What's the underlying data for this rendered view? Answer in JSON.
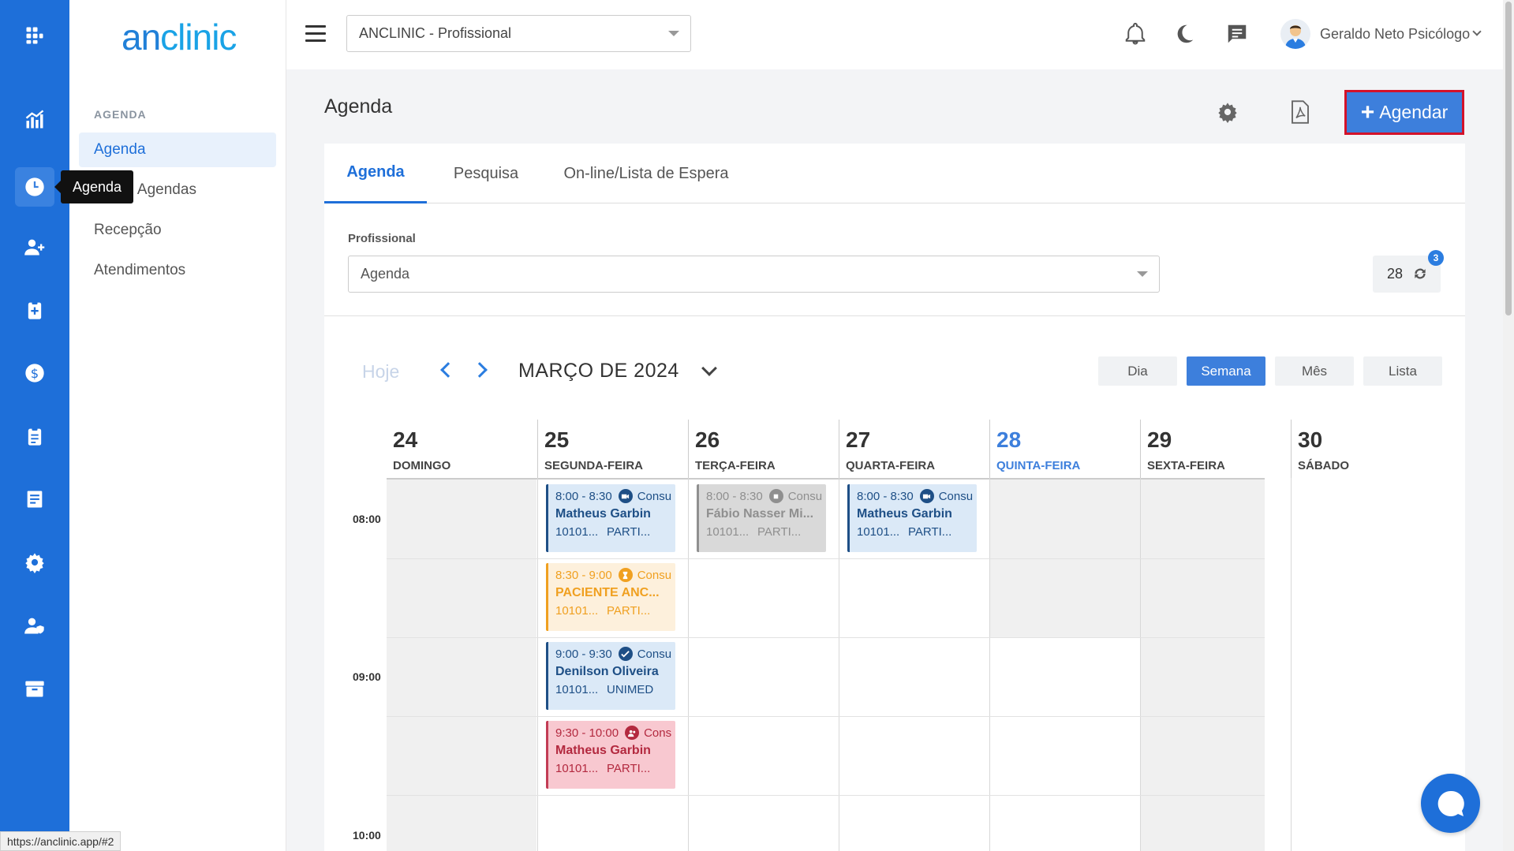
{
  "brand": {
    "logo_text_a": "an",
    "logo_text_b": "clinic"
  },
  "rail": {
    "items": [
      "apps-icon",
      "chart-icon",
      "clock-icon",
      "user-add-icon",
      "clipboard-plus-icon",
      "dollar-icon",
      "clipboard-list-icon",
      "document-icon",
      "gear-icon",
      "user-shield-icon",
      "archive-icon"
    ],
    "tooltip": "Agenda"
  },
  "sidebar": {
    "section": "AGENDA",
    "items": [
      {
        "label": "Agenda",
        "active": true
      },
      {
        "label": "Todas Agendas"
      },
      {
        "label": "Recepção"
      },
      {
        "label": "Atendimentos"
      }
    ]
  },
  "topbar": {
    "clinic_select": "ANCLINIC - Profissional",
    "user_name": "Geraldo Neto Psicólogo"
  },
  "page": {
    "title": "Agenda",
    "agendar_label": "Agendar",
    "tabs": [
      "Agenda",
      "Pesquisa",
      "On-line/Lista de Espera"
    ],
    "profissional_label": "Profissional",
    "profissional_value": "Agenda",
    "count": "28",
    "badge": "3"
  },
  "calendar": {
    "hoje": "Hoje",
    "month": "MARÇO DE 2024",
    "views": [
      "Dia",
      "Semana",
      "Mês",
      "Lista"
    ],
    "active_view": "Semana",
    "days": [
      {
        "num": "24",
        "name": "DOMINGO"
      },
      {
        "num": "25",
        "name": "SEGUNDA-FEIRA"
      },
      {
        "num": "26",
        "name": "TERÇA-FEIRA"
      },
      {
        "num": "27",
        "name": "QUARTA-FEIRA"
      },
      {
        "num": "28",
        "name": "QUINTA-FEIRA",
        "today": true
      },
      {
        "num": "29",
        "name": "SEXTA-FEIRA"
      },
      {
        "num": "30",
        "name": "SÁBADO"
      }
    ],
    "times": [
      "08:00",
      "09:00",
      "10:00"
    ],
    "events": [
      {
        "time": "8:00 - 8:30",
        "type": "Consu",
        "name": "Matheus Garbin",
        "code": "10101...",
        "plan": "PARTI...",
        "color": "blue",
        "icon": "video-icon"
      },
      {
        "time": "8:30 - 9:00",
        "type": "Consu",
        "name": "PACIENTE ANC...",
        "code": "10101...",
        "plan": "PARTI...",
        "color": "orange",
        "icon": "hourglass-icon"
      },
      {
        "time": "9:00 - 9:30",
        "type": "Consu",
        "name": "Denilson Oliveira",
        "code": "10101...",
        "plan": "UNIMED",
        "color": "blue",
        "icon": "check-icon"
      },
      {
        "time": "9:30 - 10:00",
        "type": "Cons",
        "name": "Matheus Garbin",
        "code": "10101...",
        "plan": "PARTI...",
        "color": "red",
        "icon": "user-group-icon"
      },
      {
        "time": "8:00 - 8:30",
        "type": "Consu",
        "name": "Fábio Nasser Mi...",
        "code": "10101...",
        "plan": "PARTI...",
        "color": "gray",
        "icon": "stop-icon"
      },
      {
        "time": "8:00 - 8:30",
        "type": "Consu",
        "name": "Matheus Garbin",
        "code": "10101...",
        "plan": "PARTI...",
        "color": "blue",
        "icon": "video-icon"
      }
    ]
  },
  "status_url": "https://anclinic.app/#2",
  "colors": {
    "primary": "#1e6fd9",
    "accent_border": "#d3122a"
  }
}
